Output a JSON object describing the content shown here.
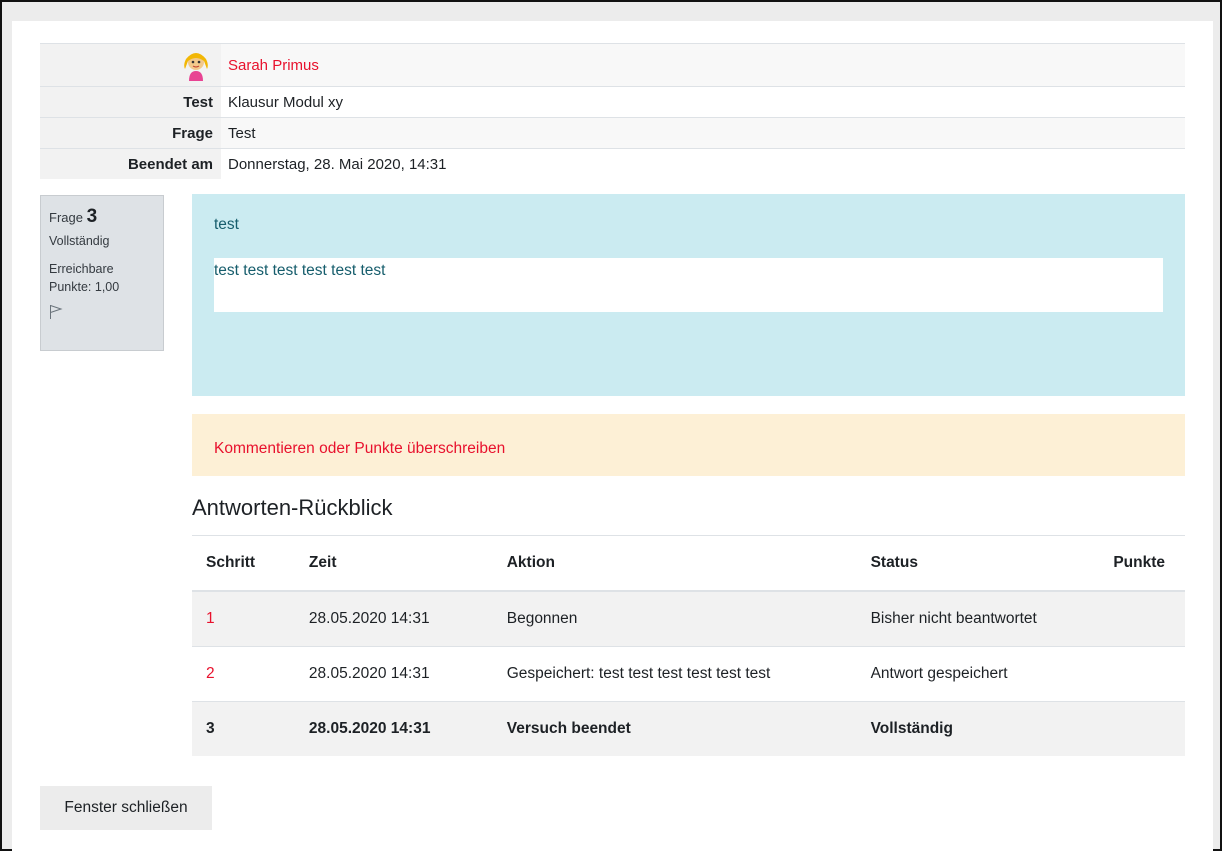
{
  "summary": {
    "user_name": "Sarah Primus",
    "rows": [
      {
        "label": "Test",
        "value": "Klausur Modul xy"
      },
      {
        "label": "Frage",
        "value": "Test"
      },
      {
        "label": "Beendet am",
        "value": "Donnerstag, 28. Mai 2020, 14:31"
      }
    ]
  },
  "question_info": {
    "prefix": "Frage",
    "number": "3",
    "state": "Vollständig",
    "grade_line1": "Erreichbare",
    "grade_line2": "Punkte: 1,00",
    "flag_icon": "flag-icon"
  },
  "question": {
    "text": "test",
    "answer": "test test test test test test"
  },
  "comment_link": "Kommentieren oder Punkte überschreiben",
  "history": {
    "title": "Antworten-Rückblick",
    "columns": [
      "Schritt",
      "Zeit",
      "Aktion",
      "Status",
      "Punkte"
    ],
    "rows": [
      {
        "step": "1",
        "time": "28.05.2020 14:31",
        "action": "Begonnen",
        "status": "Bisher nicht beantwortet",
        "points": ""
      },
      {
        "step": "2",
        "time": "28.05.2020 14:31",
        "action": "Gespeichert: test test test test test test",
        "status": "Antwort gespeichert",
        "points": ""
      },
      {
        "step": "3",
        "time": "28.05.2020 14:31",
        "action": "Versuch beendet",
        "status": "Vollständig",
        "points": ""
      }
    ]
  },
  "close_button": "Fenster schließen",
  "colors": {
    "link": "#e8112d",
    "question_bg": "#cbebf1",
    "comment_bg": "#fdf0d6"
  }
}
